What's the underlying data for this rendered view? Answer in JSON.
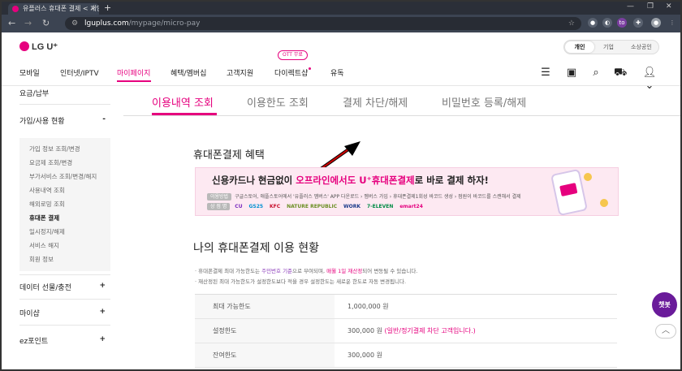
{
  "browser": {
    "tab_title": "유플러스 휴대폰 결제 < 개인",
    "tab_close": "×",
    "new_tab": "+",
    "url_host": "lguplus.com",
    "url_path": "/mypage/micro-pay",
    "window_controls": [
      "—",
      "❐",
      "✕"
    ],
    "extension_label": "to"
  },
  "site": {
    "logo_text": "LG U⁺",
    "audience_tabs": [
      "개인",
      "기업",
      "소상공인"
    ],
    "nav": [
      "모바일",
      "인터넷/IPTV",
      "마이페이지",
      "혜택/멤버십",
      "고객지원",
      "다이렉트샵",
      "유독"
    ],
    "ott_badge": "OTT 무료"
  },
  "sidebar": {
    "top_item": "요금/납부",
    "group_open": {
      "label": "가입/사용 현황",
      "sign": "-"
    },
    "sub_items": [
      "가입 정보 조회/변경",
      "요금제 조회/변경",
      "부가서비스 조회/변경/해지",
      "사용내역 조회",
      "해외로밍 조회",
      "휴대폰 결제",
      "일시정지/해제",
      "서비스 해지",
      "회원 정보"
    ],
    "more": [
      {
        "label": "데이터 선물/충전",
        "sign": "+"
      },
      {
        "label": "마이샵",
        "sign": "+"
      },
      {
        "label": "ez포인트",
        "sign": "+"
      }
    ]
  },
  "subtabs": [
    "이용내역 조회",
    "이용한도 조회",
    "결제 차단/해제",
    "비밀번호 등록/해제"
  ],
  "benefit": {
    "title": "휴대폰결제 혜택",
    "headline_pre": "신용카드나 현금없이 ",
    "headline_pink": "오프라인에서도 U⁺휴대폰결제",
    "headline_post": "로 바로 결제 하자!",
    "method_chip": "이용방법",
    "method_text": "구글스토어, 애플스토어에서 '유플러스 멤버스' APP 다운로드 › 멤버스 가입 › 휴대폰결제1회성 바코드 생성 › 점원이 바코드를 스캔해서 결제",
    "shops_chip": "상 점 명",
    "shops": [
      "CU",
      "GS25",
      "KFC",
      "NATURE REPUBLIC",
      "WORK",
      "7-ELEVEN",
      "emart24"
    ]
  },
  "status": {
    "title": "나의 휴대폰결제 이용 현황",
    "note1_pre": "· 휴대폰결제 최대 가능한도는 ",
    "note1_b": "주민번호 기준",
    "note1_mid": "으로 부여되며, ",
    "note1_m": "매월 1일 재산정",
    "note1_post": "되어 변동될 수 있습니다.",
    "note2": "· 재산정된 최대 가능한도가 설정한도보다 적을 경우 설정한도는 새로운 한도로 자동 변경됩니다.",
    "rows": [
      {
        "label": "최대 가능한도",
        "value": "1,000,000 원",
        "warn": ""
      },
      {
        "label": "설정한도",
        "value": "300,000 원 ",
        "warn": "(일반/정기결제 차단 고객입니다.)"
      },
      {
        "label": "잔여한도",
        "value": "300,000 원",
        "warn": ""
      }
    ]
  },
  "chatbot_label": "챗봇",
  "top_label": "︿"
}
